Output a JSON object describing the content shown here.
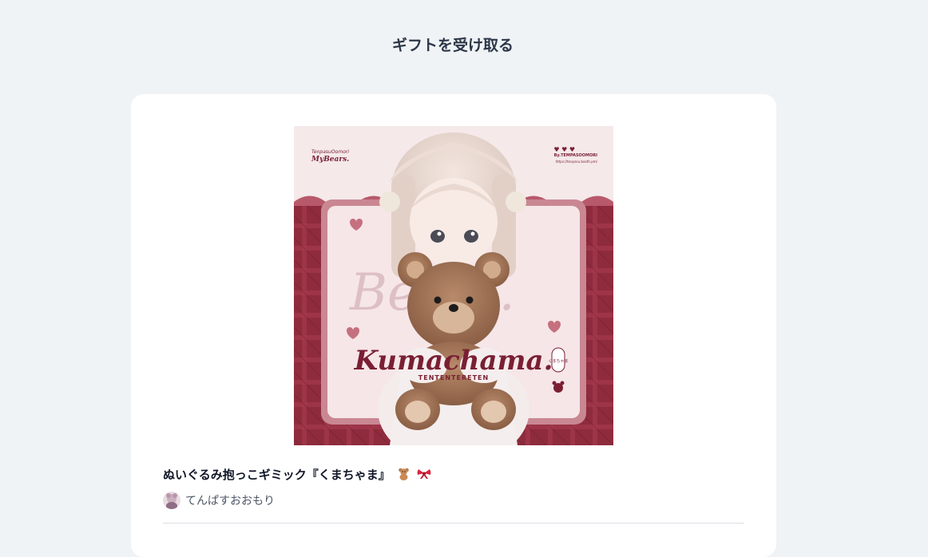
{
  "page": {
    "title": "ギフトを受け取る"
  },
  "product": {
    "name": "ぬいぐるみ抱っこギミック『くまちゃま』",
    "name_emoji_icons": [
      "teddy-bear-icon",
      "ribbon-icon"
    ],
    "image": {
      "brand_mark_line1": "TenpasuOomori",
      "brand_mark_line2": "MyBears.",
      "byline": "By.TEMPASOOMORI",
      "url": "https://tenpasu.booth.pm/",
      "title_text": "Kumachama.",
      "subtitle_text": "TENTENTERETEN",
      "side_tag": "くまちゃま"
    }
  },
  "shop": {
    "name": "てんぱすおおもり"
  },
  "colors": {
    "page_bg": "#f0f3f6",
    "card_bg": "#ffffff",
    "accent_wine": "#7a1f33",
    "accent_pink": "#f6e6e8"
  }
}
